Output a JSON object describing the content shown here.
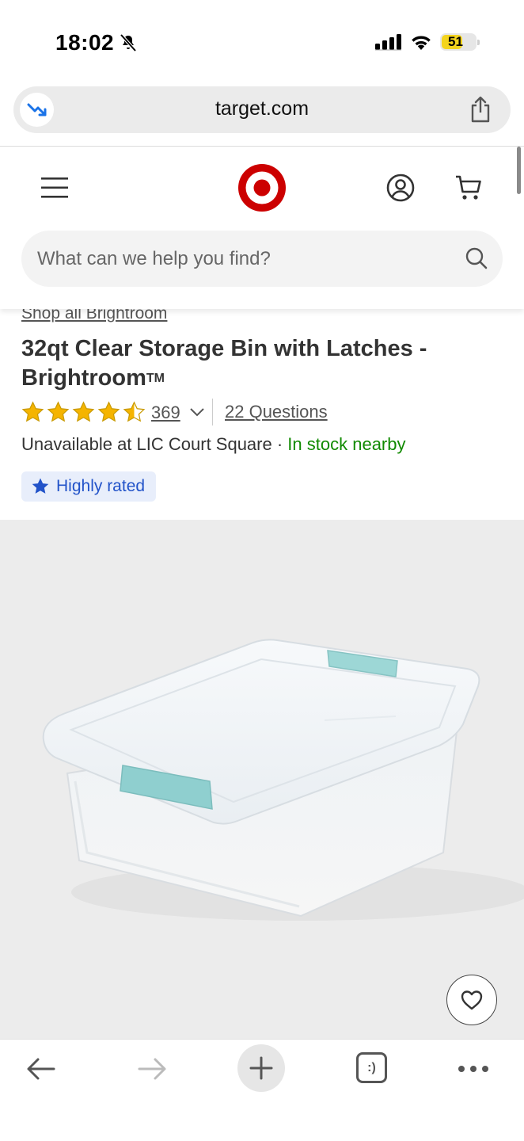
{
  "status_bar": {
    "time": "18:02",
    "battery_level": "51",
    "icons": [
      "bell-slash-icon",
      "cellular-signal-icon",
      "wifi-icon",
      "battery-icon"
    ]
  },
  "browser": {
    "url": "target.com",
    "icons": [
      "tracking-icon",
      "share-icon"
    ],
    "toolbar": [
      "back-arrow-icon",
      "forward-arrow-icon",
      "new-tab-plus-icon",
      "tabs-icon",
      "more-icon"
    ],
    "tabs_glyph": ":)"
  },
  "header": {
    "icons": [
      "hamburger-menu-icon",
      "target-logo",
      "account-icon",
      "cart-icon"
    ],
    "search_placeholder": "What can we help you find?",
    "brand_color": "#cc0000"
  },
  "product": {
    "shop_all_link": "Shop all Brightroom",
    "title": "32qt Clear Storage Bin with Latches - Brightroom",
    "trademark": "TM",
    "rating": 4.5,
    "rating_max": 5,
    "review_count": "369",
    "questions_link": "22 Questions",
    "availability_prefix": "Unavailable at LIC Court Square",
    "availability_separator": " · ",
    "availability_status": "In stock nearby",
    "badge": "Highly rated",
    "star_color": "#f5b400",
    "in_stock_color": "#108a00",
    "badge_color": "#2253c9"
  }
}
